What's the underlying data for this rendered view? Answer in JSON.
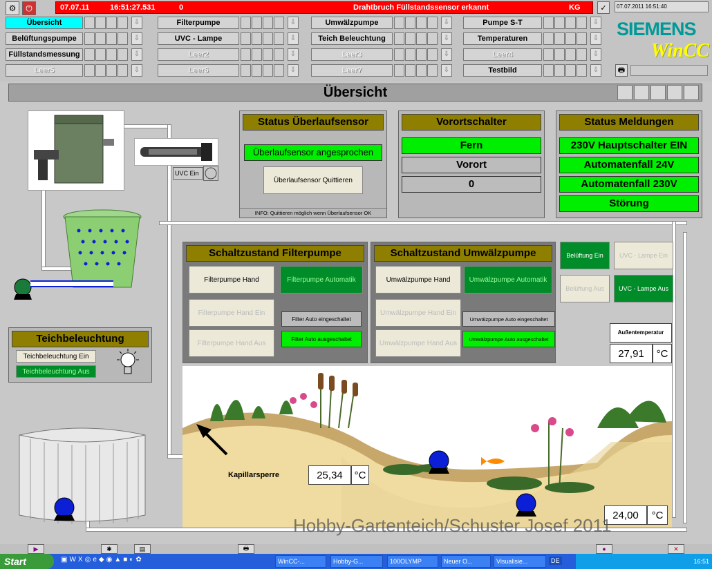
{
  "alarm": {
    "date": "07.07.11",
    "time": "16:51:27.531",
    "count": "0",
    "message": "Drahtbruch Füllstandssensor erkannt",
    "code": "KG"
  },
  "datetime": "07.07.2011 16:51:40",
  "brand": {
    "siemens": "SIEMENS",
    "wincc": "WinCC"
  },
  "nav": [
    [
      "Übersicht",
      "Filterpumpe",
      "Umwälzpumpe",
      "Pumpe S-T"
    ],
    [
      "Belüftungspumpe",
      "UVC - Lampe",
      "Teich Beleuchtung",
      "Temperaturen"
    ],
    [
      "Füllstandsmessung",
      "Leer2",
      "Leer3",
      "Leer4"
    ],
    [
      "Leer5",
      "Leer6",
      "Leer7",
      "Testbild"
    ]
  ],
  "page_title": "Übersicht",
  "uvc_label": "UVC Ein",
  "overflow": {
    "title": "Status Überlaufsensor",
    "status": "Überlaufsensor angesprochen",
    "button": "Überlaufsensor Quittieren",
    "info": "INFO: Quittieren möglich wenn Überlaufsensor OK"
  },
  "vorort": {
    "title": "Vorortschalter",
    "fern": "Fern",
    "vorort": "Vorort",
    "value": "0"
  },
  "meldungen": {
    "title": "Status Meldungen",
    "items": [
      "230V Hauptschalter EIN",
      "Automatenfall 24V",
      "Automatenfall 230V",
      "Störung"
    ]
  },
  "filter": {
    "title": "Schaltzustand Filterpumpe",
    "hand": "Filterpumpe Hand",
    "auto": "Filterpumpe Automatik",
    "hand_ein": "Filterpumpe Hand Ein",
    "hand_aus": "Filterpumpe Hand Aus",
    "auto_ein": "Filter Auto eingeschaltet",
    "auto_aus": "Filter Auto ausgeschaltet"
  },
  "umwaelz": {
    "title": "Schaltzustand Umwälzpumpe",
    "hand": "Umwälzpumpe Hand",
    "auto": "Umwälzpumpe Automatik",
    "hand_ein": "Umwälzpumpe Hand Ein",
    "hand_aus": "Umwälzpumpe Hand Aus",
    "auto_ein": "Umwälzpumpe Auto eingeschaltet",
    "auto_aus": "Umwälzpumpe Auto ausgeschaltet"
  },
  "right_btns": {
    "bel_ein": "Belüftung Ein",
    "uvc_ein": "UVC - Lampe Ein",
    "bel_aus": "Belüftung Aus",
    "uvc_aus": "UVC - Lampe Aus"
  },
  "aussen": {
    "label": "Außentemperatur",
    "value": "27,91",
    "unit": "°C"
  },
  "teich": {
    "title": "Teichbeleuchtung",
    "ein": "Teichbeleuchtung  Ein",
    "aus": "Teichbeleuchtung Aus"
  },
  "kapillar": {
    "label": "Kapillarsperre",
    "value": "25,34",
    "unit": "°C"
  },
  "water_temp": {
    "value": "24,00",
    "unit": "°C"
  },
  "watermark": "Hobby-Gartenteich/Schuster Josef 2011",
  "taskbar": {
    "start": "Start",
    "tasks": [
      "WinCC-...",
      "Hobby-G...",
      "100OLYMP",
      "Neuer O...",
      "Visualisie..."
    ],
    "lang": "DE",
    "clock": "16:51"
  },
  "colors": {
    "alarm": "#ff0000",
    "active_nav": "#00ffff",
    "status_green": "#00ee00",
    "panel_title": "#8f7f00",
    "siemens": "#009999",
    "wincc": "#ffff00"
  }
}
